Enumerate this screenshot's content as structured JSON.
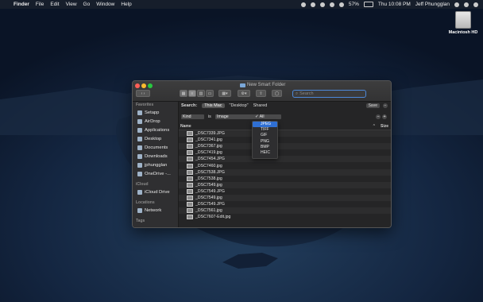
{
  "menubar": {
    "app": "Finder",
    "items": [
      "File",
      "Edit",
      "View",
      "Go",
      "Window",
      "Help"
    ],
    "battery": "57%",
    "datetime": "Thu 10:08 PM",
    "user": "Jeff Phungglan"
  },
  "desktop": {
    "drive_label": "Macintosh HD"
  },
  "window": {
    "title": "New Smart Folder",
    "search_placeholder": "Search",
    "scope_label": "Search:",
    "scope_options": [
      "This Mac",
      "\"Desktop\"",
      "Shared"
    ],
    "save_label": "Save",
    "criteria": {
      "attribute": "Kind",
      "operator": "is",
      "value": "Image",
      "subvalue": "All"
    },
    "columns": {
      "name": "Name",
      "size": "Size"
    }
  },
  "sidebar": {
    "favorites_title": "Favorites",
    "favorites": [
      "Setapp",
      "AirDrop",
      "Applications",
      "Desktop",
      "Documents",
      "Downloads",
      "jphungglan",
      "OneDrive -..."
    ],
    "icloud_title": "iCloud",
    "icloud": [
      "iCloud Drive"
    ],
    "locations_title": "Locations",
    "locations": [
      "Network"
    ],
    "tags_title": "Tags"
  },
  "files": [
    "_DSC7339.JPG",
    "_DSC7341.jpg",
    "_DSC7367.jpg",
    "_DSC7419.jpg",
    "_DSC7454.JPG",
    "_DSC7460.jpg",
    "_DSC7538.JPG",
    "_DSC7538.jpg",
    "_DSC7549.jpg",
    "_DSC7549.JPG",
    "_DSC7549.jpg",
    "_DSC7549.JPG",
    "_DSC7561.jpg",
    "_DSC7607-Edit.jpg"
  ],
  "dropdown": {
    "items": [
      "JPEG",
      "TIFF",
      "GIF",
      "PNG",
      "BMP",
      "HEIC"
    ],
    "highlighted": "JPEG"
  }
}
